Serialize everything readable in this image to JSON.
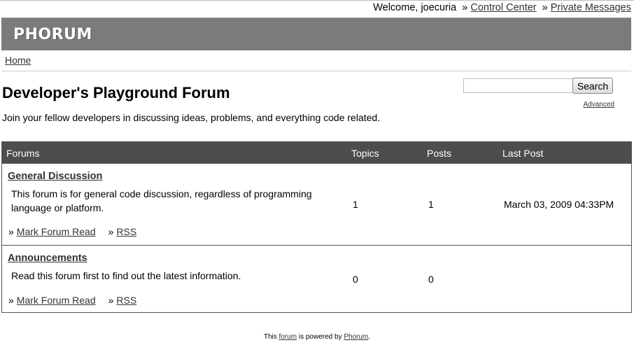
{
  "userbar": {
    "welcome": "Welcome, joecuria",
    "separator": "»",
    "control_center": "Control Center",
    "private_messages": "Private Messages"
  },
  "header": {
    "logo": "PHORUM"
  },
  "breadcrumb": {
    "home": "Home"
  },
  "page": {
    "title": "Developer's Playground Forum",
    "description": "Join your fellow developers in discussing ideas, problems, and everything code related."
  },
  "search": {
    "value": "",
    "button_label": "Search",
    "advanced_label": "Advanced"
  },
  "table": {
    "headers": {
      "forums": "Forums",
      "topics": "Topics",
      "posts": "Posts",
      "last_post": "Last Post"
    },
    "rows": [
      {
        "name": "General Discussion",
        "description": "This forum is for general code discussion, regardless of programming language or platform.",
        "topics": "1",
        "posts": "1",
        "last_post": "March 03, 2009 04:33PM",
        "mark_read": "Mark Forum Read",
        "rss": "RSS",
        "link_prefix": "»"
      },
      {
        "name": "Announcements",
        "description": "Read this forum first to find out the latest information.",
        "topics": "0",
        "posts": "0",
        "last_post": "",
        "mark_read": "Mark Forum Read",
        "rss": "RSS",
        "link_prefix": "»"
      }
    ]
  },
  "footer": {
    "prefix": "This",
    "forum_link": "forum",
    "middle": "is powered by",
    "phorum_link": "Phorum",
    "suffix": "."
  }
}
